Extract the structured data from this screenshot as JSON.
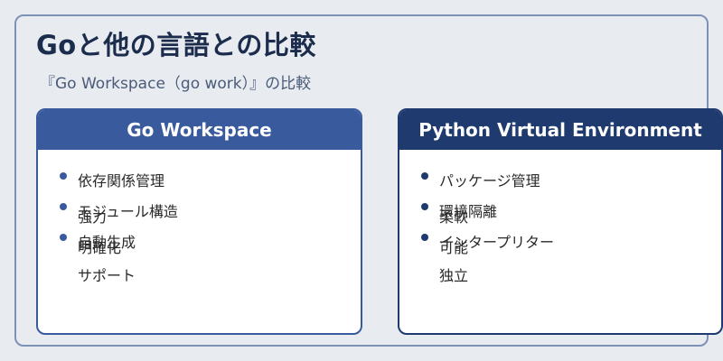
{
  "title": "Goと他の言語との比較",
  "subtitle": "『Go Workspace（go work）』の比較",
  "cards": [
    {
      "header": "Go Workspace",
      "items": [
        "依存関係管理",
        "モジュール構造",
        "強力",
        "自動生成",
        "明確化",
        "サポート"
      ]
    },
    {
      "header": "Python Virtual Environment",
      "items": [
        "パッケージ管理",
        "環境隔離",
        "柔軟",
        "インタープリター",
        "可能",
        "独立"
      ]
    }
  ]
}
